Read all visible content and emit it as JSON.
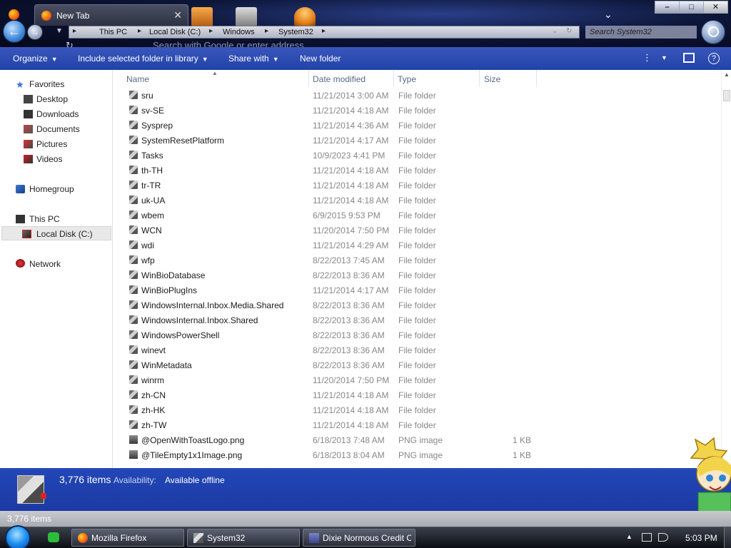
{
  "browser": {
    "tab_title": "New Tab",
    "url_placeholder": "Search with Google or enter address"
  },
  "explorer": {
    "breadcrumb": [
      "This PC",
      "Local Disk (C:)",
      "Windows",
      "System32"
    ],
    "search_placeholder": "Search System32",
    "commands": {
      "organize": "Organize",
      "include_library": "Include selected folder in library",
      "share_with": "Share with",
      "new_folder": "New folder"
    },
    "columns": {
      "name": "Name",
      "date_modified": "Date modified",
      "type": "Type",
      "size": "Size"
    },
    "navigation": {
      "favorites": "Favorites",
      "desktop": "Desktop",
      "downloads": "Downloads",
      "documents": "Documents",
      "pictures": "Pictures",
      "videos": "Videos",
      "homegroup": "Homegroup",
      "this_pc": "This PC",
      "local_disk": "Local Disk (C:)",
      "network": "Network"
    },
    "files": [
      {
        "name": "sru",
        "date": "11/21/2014 3:00 AM",
        "type": "File folder",
        "size": "",
        "kind": "folder"
      },
      {
        "name": "sv-SE",
        "date": "11/21/2014 4:18 AM",
        "type": "File folder",
        "size": "",
        "kind": "folder"
      },
      {
        "name": "Sysprep",
        "date": "11/21/2014 4:36 AM",
        "type": "File folder",
        "size": "",
        "kind": "folder"
      },
      {
        "name": "SystemResetPlatform",
        "date": "11/21/2014 4:17 AM",
        "type": "File folder",
        "size": "",
        "kind": "folder"
      },
      {
        "name": "Tasks",
        "date": "10/9/2023 4:41 PM",
        "type": "File folder",
        "size": "",
        "kind": "folder"
      },
      {
        "name": "th-TH",
        "date": "11/21/2014 4:18 AM",
        "type": "File folder",
        "size": "",
        "kind": "folder"
      },
      {
        "name": "tr-TR",
        "date": "11/21/2014 4:18 AM",
        "type": "File folder",
        "size": "",
        "kind": "folder"
      },
      {
        "name": "uk-UA",
        "date": "11/21/2014 4:18 AM",
        "type": "File folder",
        "size": "",
        "kind": "folder"
      },
      {
        "name": "wbem",
        "date": "6/9/2015 9:53 PM",
        "type": "File folder",
        "size": "",
        "kind": "folder"
      },
      {
        "name": "WCN",
        "date": "11/20/2014 7:50 PM",
        "type": "File folder",
        "size": "",
        "kind": "folder"
      },
      {
        "name": "wdi",
        "date": "11/21/2014 4:29 AM",
        "type": "File folder",
        "size": "",
        "kind": "folder"
      },
      {
        "name": "wfp",
        "date": "8/22/2013 7:45 AM",
        "type": "File folder",
        "size": "",
        "kind": "folder"
      },
      {
        "name": "WinBioDatabase",
        "date": "8/22/2013 8:36 AM",
        "type": "File folder",
        "size": "",
        "kind": "folder"
      },
      {
        "name": "WinBioPlugIns",
        "date": "11/21/2014 4:17 AM",
        "type": "File folder",
        "size": "",
        "kind": "folder"
      },
      {
        "name": "WindowsInternal.Inbox.Media.Shared",
        "date": "8/22/2013 8:36 AM",
        "type": "File folder",
        "size": "",
        "kind": "folder"
      },
      {
        "name": "WindowsInternal.Inbox.Shared",
        "date": "8/22/2013 8:36 AM",
        "type": "File folder",
        "size": "",
        "kind": "folder"
      },
      {
        "name": "WindowsPowerShell",
        "date": "8/22/2013 8:36 AM",
        "type": "File folder",
        "size": "",
        "kind": "folder"
      },
      {
        "name": "winevt",
        "date": "8/22/2013 8:36 AM",
        "type": "File folder",
        "size": "",
        "kind": "folder"
      },
      {
        "name": "WinMetadata",
        "date": "8/22/2013 8:36 AM",
        "type": "File folder",
        "size": "",
        "kind": "folder"
      },
      {
        "name": "winrm",
        "date": "11/20/2014 7:50 PM",
        "type": "File folder",
        "size": "",
        "kind": "folder"
      },
      {
        "name": "zh-CN",
        "date": "11/21/2014 4:18 AM",
        "type": "File folder",
        "size": "",
        "kind": "folder"
      },
      {
        "name": "zh-HK",
        "date": "11/21/2014 4:18 AM",
        "type": "File folder",
        "size": "",
        "kind": "folder"
      },
      {
        "name": "zh-TW",
        "date": "11/21/2014 4:18 AM",
        "type": "File folder",
        "size": "",
        "kind": "folder"
      },
      {
        "name": "@OpenWithToastLogo.png",
        "date": "6/18/2013 7:48 AM",
        "type": "PNG image",
        "size": "1 KB",
        "kind": "file"
      },
      {
        "name": "@TileEmpty1x1Image.png",
        "date": "6/18/2013 8:04 AM",
        "type": "PNG image",
        "size": "1 KB",
        "kind": "file"
      }
    ],
    "details": {
      "item_count": "3,776 items",
      "availability_label": "Availability:",
      "availability_value": "Available offline"
    },
    "status_text": "3,776 items"
  },
  "taskbar": {
    "buttons": [
      "Mozilla Firefox",
      "System32",
      "Dixie Normous Credit C..."
    ],
    "clock": "5:03 PM"
  },
  "icons": {
    "back": "back-arrow-icon",
    "forward": "forward-arrow-icon",
    "search": "magnifier-icon",
    "folder": "folder-icon",
    "file": "png-file-icon"
  }
}
